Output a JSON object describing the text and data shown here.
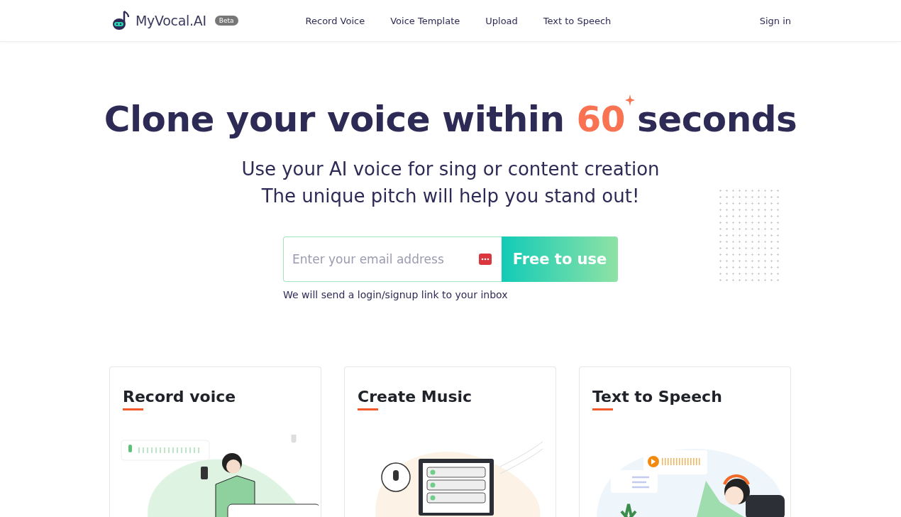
{
  "header": {
    "logo": "MyVocal.AI",
    "badge": "Beta",
    "nav": [
      "Record Voice",
      "Voice Template",
      "Upload",
      "Text to Speech"
    ],
    "sign_in": "Sign in"
  },
  "hero": {
    "title_before": "Clone your voice within",
    "title_highlight": "60",
    "title_after": "seconds",
    "subtitle": [
      "Use your AI voice for sing or content creation",
      "The unique pitch will help you stand out!"
    ],
    "email": {
      "placeholder": "Enter your email address"
    },
    "button": "Free to use",
    "note": "We will send a login/signup link to your inbox"
  },
  "cards": [
    {
      "kind": "record",
      "title": "Record voice"
    },
    {
      "kind": "music",
      "title": "Create Music"
    },
    {
      "kind": "tts",
      "title": "Text to Speech"
    }
  ]
}
